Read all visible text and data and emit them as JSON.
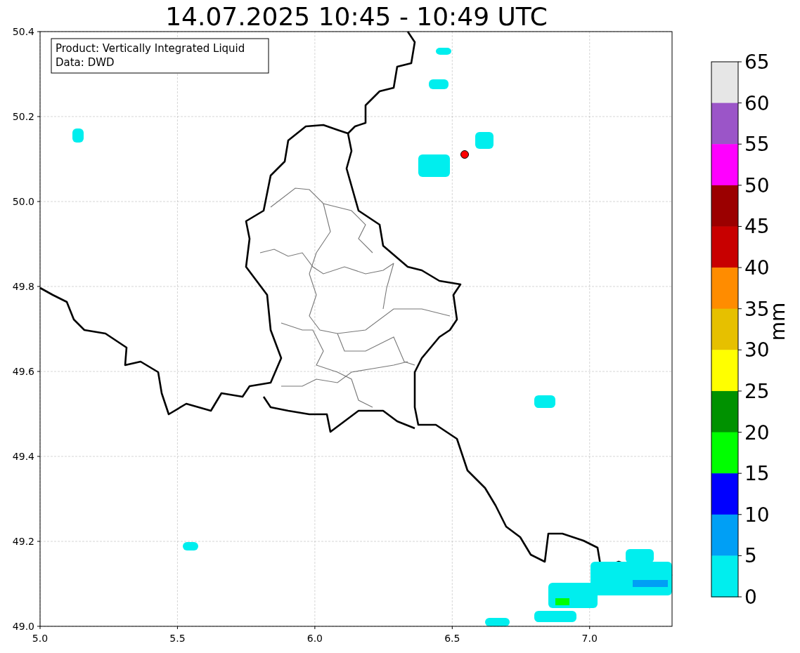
{
  "title": "14.07.2025 10:45 - 10:49 UTC",
  "info_box": [
    "Product: Vertically Integrated Liquid",
    "Data: DWD"
  ],
  "x_ticks": [
    "5.0",
    "5.5",
    "6.0",
    "6.5",
    "7.0"
  ],
  "y_ticks": [
    "50.4",
    "50.2",
    "50.0",
    "49.8",
    "49.6",
    "49.4",
    "49.2",
    "49.0"
  ],
  "colorbar": {
    "unit": "mm",
    "tick_labels": [
      "65",
      "60",
      "55",
      "50",
      "45",
      "40",
      "35",
      "30",
      "25",
      "20",
      "15",
      "10",
      "5",
      "0"
    ],
    "bins": [
      {
        "color": "#e6e6e6"
      },
      {
        "color": "#9b55c8"
      },
      {
        "color": "#ff00ff"
      },
      {
        "color": "#9b0000"
      },
      {
        "color": "#c80000"
      },
      {
        "color": "#ff8c00"
      },
      {
        "color": "#e6c000"
      },
      {
        "color": "#ffff00"
      },
      {
        "color": "#009100"
      },
      {
        "color": "#00ff00"
      },
      {
        "color": "#0000ff"
      },
      {
        "color": "#009ff5"
      },
      {
        "color": "#00eeee"
      }
    ]
  }
}
